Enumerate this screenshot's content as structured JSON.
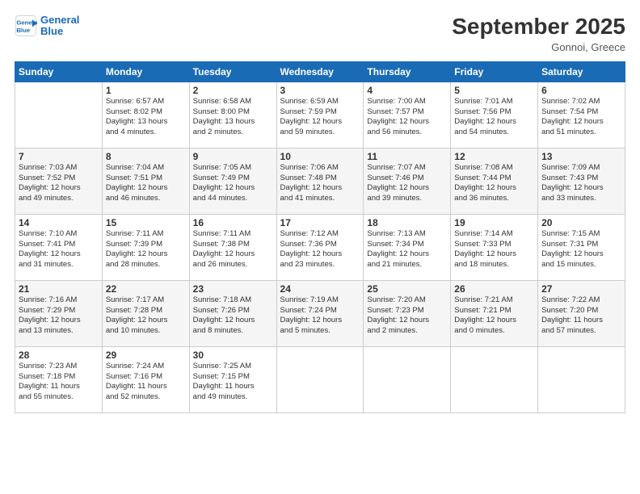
{
  "header": {
    "logo_line1": "General",
    "logo_line2": "Blue",
    "month_title": "September 2025",
    "location": "Gonnoi, Greece"
  },
  "days_of_week": [
    "Sunday",
    "Monday",
    "Tuesday",
    "Wednesday",
    "Thursday",
    "Friday",
    "Saturday"
  ],
  "weeks": [
    [
      {
        "num": "",
        "info": ""
      },
      {
        "num": "1",
        "info": "Sunrise: 6:57 AM\nSunset: 8:02 PM\nDaylight: 13 hours\nand 4 minutes."
      },
      {
        "num": "2",
        "info": "Sunrise: 6:58 AM\nSunset: 8:00 PM\nDaylight: 13 hours\nand 2 minutes."
      },
      {
        "num": "3",
        "info": "Sunrise: 6:59 AM\nSunset: 7:59 PM\nDaylight: 12 hours\nand 59 minutes."
      },
      {
        "num": "4",
        "info": "Sunrise: 7:00 AM\nSunset: 7:57 PM\nDaylight: 12 hours\nand 56 minutes."
      },
      {
        "num": "5",
        "info": "Sunrise: 7:01 AM\nSunset: 7:56 PM\nDaylight: 12 hours\nand 54 minutes."
      },
      {
        "num": "6",
        "info": "Sunrise: 7:02 AM\nSunset: 7:54 PM\nDaylight: 12 hours\nand 51 minutes."
      }
    ],
    [
      {
        "num": "7",
        "info": "Sunrise: 7:03 AM\nSunset: 7:52 PM\nDaylight: 12 hours\nand 49 minutes."
      },
      {
        "num": "8",
        "info": "Sunrise: 7:04 AM\nSunset: 7:51 PM\nDaylight: 12 hours\nand 46 minutes."
      },
      {
        "num": "9",
        "info": "Sunrise: 7:05 AM\nSunset: 7:49 PM\nDaylight: 12 hours\nand 44 minutes."
      },
      {
        "num": "10",
        "info": "Sunrise: 7:06 AM\nSunset: 7:48 PM\nDaylight: 12 hours\nand 41 minutes."
      },
      {
        "num": "11",
        "info": "Sunrise: 7:07 AM\nSunset: 7:46 PM\nDaylight: 12 hours\nand 39 minutes."
      },
      {
        "num": "12",
        "info": "Sunrise: 7:08 AM\nSunset: 7:44 PM\nDaylight: 12 hours\nand 36 minutes."
      },
      {
        "num": "13",
        "info": "Sunrise: 7:09 AM\nSunset: 7:43 PM\nDaylight: 12 hours\nand 33 minutes."
      }
    ],
    [
      {
        "num": "14",
        "info": "Sunrise: 7:10 AM\nSunset: 7:41 PM\nDaylight: 12 hours\nand 31 minutes."
      },
      {
        "num": "15",
        "info": "Sunrise: 7:11 AM\nSunset: 7:39 PM\nDaylight: 12 hours\nand 28 minutes."
      },
      {
        "num": "16",
        "info": "Sunrise: 7:11 AM\nSunset: 7:38 PM\nDaylight: 12 hours\nand 26 minutes."
      },
      {
        "num": "17",
        "info": "Sunrise: 7:12 AM\nSunset: 7:36 PM\nDaylight: 12 hours\nand 23 minutes."
      },
      {
        "num": "18",
        "info": "Sunrise: 7:13 AM\nSunset: 7:34 PM\nDaylight: 12 hours\nand 21 minutes."
      },
      {
        "num": "19",
        "info": "Sunrise: 7:14 AM\nSunset: 7:33 PM\nDaylight: 12 hours\nand 18 minutes."
      },
      {
        "num": "20",
        "info": "Sunrise: 7:15 AM\nSunset: 7:31 PM\nDaylight: 12 hours\nand 15 minutes."
      }
    ],
    [
      {
        "num": "21",
        "info": "Sunrise: 7:16 AM\nSunset: 7:29 PM\nDaylight: 12 hours\nand 13 minutes."
      },
      {
        "num": "22",
        "info": "Sunrise: 7:17 AM\nSunset: 7:28 PM\nDaylight: 12 hours\nand 10 minutes."
      },
      {
        "num": "23",
        "info": "Sunrise: 7:18 AM\nSunset: 7:26 PM\nDaylight: 12 hours\nand 8 minutes."
      },
      {
        "num": "24",
        "info": "Sunrise: 7:19 AM\nSunset: 7:24 PM\nDaylight: 12 hours\nand 5 minutes."
      },
      {
        "num": "25",
        "info": "Sunrise: 7:20 AM\nSunset: 7:23 PM\nDaylight: 12 hours\nand 2 minutes."
      },
      {
        "num": "26",
        "info": "Sunrise: 7:21 AM\nSunset: 7:21 PM\nDaylight: 12 hours\nand 0 minutes."
      },
      {
        "num": "27",
        "info": "Sunrise: 7:22 AM\nSunset: 7:20 PM\nDaylight: 11 hours\nand 57 minutes."
      }
    ],
    [
      {
        "num": "28",
        "info": "Sunrise: 7:23 AM\nSunset: 7:18 PM\nDaylight: 11 hours\nand 55 minutes."
      },
      {
        "num": "29",
        "info": "Sunrise: 7:24 AM\nSunset: 7:16 PM\nDaylight: 11 hours\nand 52 minutes."
      },
      {
        "num": "30",
        "info": "Sunrise: 7:25 AM\nSunset: 7:15 PM\nDaylight: 11 hours\nand 49 minutes."
      },
      {
        "num": "",
        "info": ""
      },
      {
        "num": "",
        "info": ""
      },
      {
        "num": "",
        "info": ""
      },
      {
        "num": "",
        "info": ""
      }
    ]
  ]
}
